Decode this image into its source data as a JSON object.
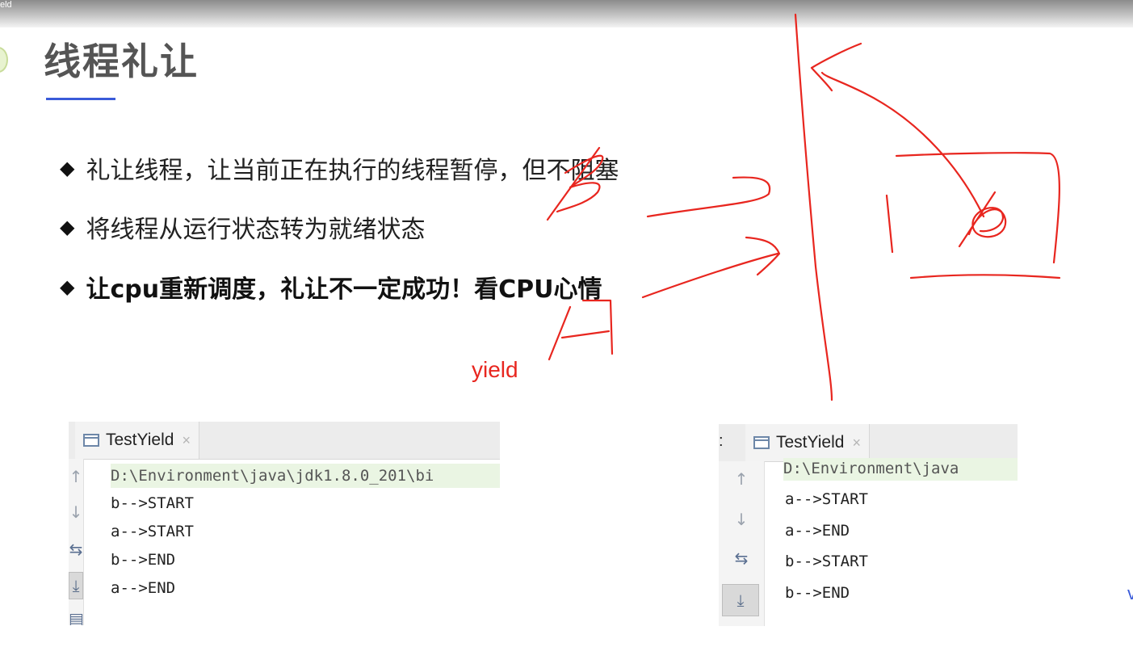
{
  "topbar": {
    "label": "eld"
  },
  "slide": {
    "title": "线程礼让",
    "bullets": [
      {
        "text": "礼让线程，让当前正在执行的线程暂停，但不阻塞",
        "bold": false
      },
      {
        "text": "将线程从运行状态转为就绪状态",
        "bold": false
      },
      {
        "text": "让cpu重新调度，礼让不一定成功！看CPU心情",
        "bold": true
      }
    ],
    "bullet_glyph": "◆",
    "annotation_label": "yield"
  },
  "colors": {
    "annotation_red": "#e8261f",
    "title_underline": "#3a5bd9",
    "command_line_bg": "#eaf5e3"
  },
  "console_left": {
    "tab_label": "TestYield",
    "tab_close": "×",
    "lines": [
      "D:\\Environment\\java\\jdk1.8.0_201\\bi",
      "b-->START",
      "a-->START",
      "b-->END",
      "a-->END"
    ],
    "tools": [
      "arrow-up-icon",
      "arrow-down-icon",
      "soft-wrap-icon",
      "scroll-to-end-icon",
      "print-icon"
    ]
  },
  "console_right": {
    "prefix": ":",
    "tab_label": "TestYield",
    "tab_close": "×",
    "lines": [
      "D:\\Environment\\java",
      "a-->START",
      "a-->END",
      "b-->START",
      "b-->END"
    ],
    "tools": [
      "arrow-up-icon",
      "arrow-down-icon",
      "soft-wrap-icon",
      "scroll-to-end-icon"
    ]
  },
  "edge_text": "v"
}
